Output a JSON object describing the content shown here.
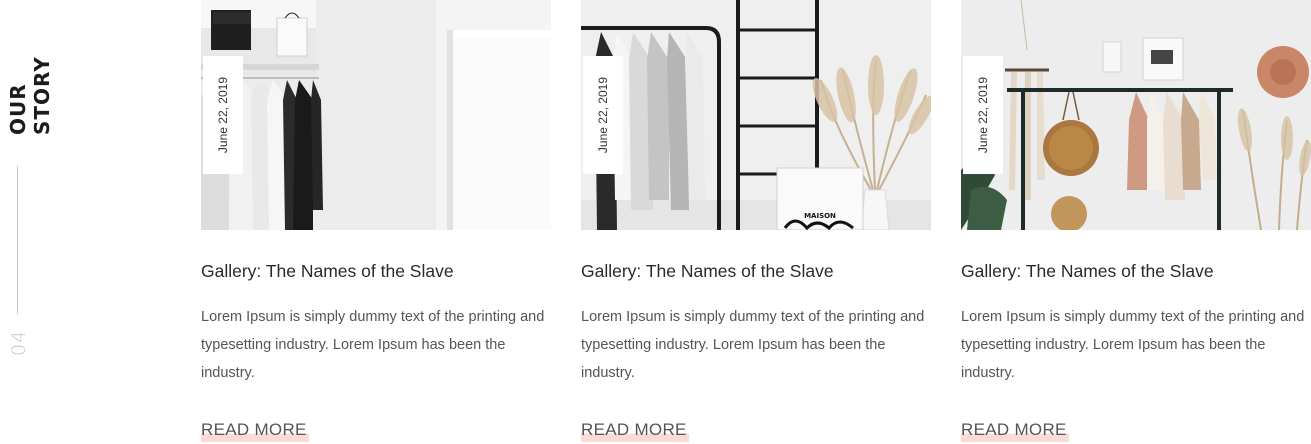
{
  "section": {
    "title": "OUR STORY",
    "number": "04"
  },
  "cards": [
    {
      "date": "June 22, 2019",
      "title": "Gallery: The Names of the Slave",
      "text": "Lorem Ipsum is simply dummy text of the printing and typesetting industry. Lorem Ipsum has been the industry.",
      "read_more": "READ MORE",
      "image": "closet-with-white-and-black-clothes"
    },
    {
      "date": "June 22, 2019",
      "title": "Gallery: The Names of the Slave",
      "text": "Lorem Ipsum is simply dummy text of the printing and typesetting industry. Lorem Ipsum has been the industry.",
      "read_more": "READ MORE",
      "image": "clothing-rack-ladder-pampas-grass",
      "image_print_text": "MAISON"
    },
    {
      "date": "June 22, 2019",
      "title": "Gallery: The Names of the Slave",
      "text": "Lorem Ipsum is simply dummy text of the printing and typesetting industry. Lorem Ipsum has been the industry.",
      "read_more": "READ MORE",
      "image": "boho-clothing-rack-with-bags-and-hat"
    }
  ],
  "colors": {
    "read_more_highlight": "#f9dcd8",
    "side_line": "#c8c8c8",
    "section_number": "#c9c9c9"
  }
}
